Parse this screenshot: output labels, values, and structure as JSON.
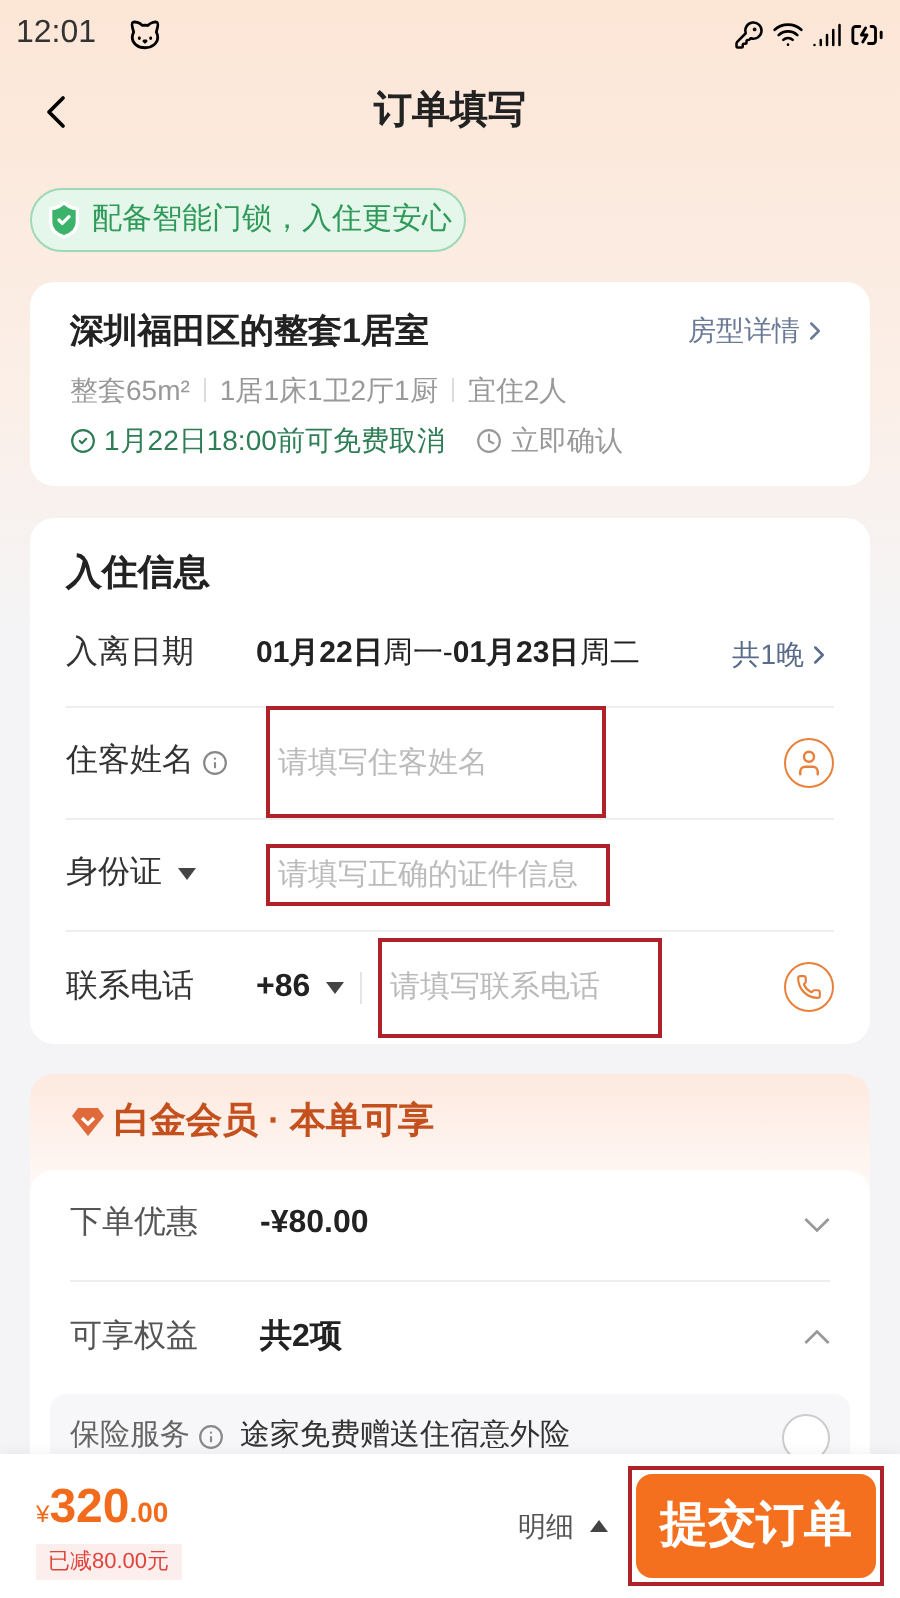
{
  "status_bar": {
    "time": "12:01"
  },
  "header": {
    "title": "订单填写"
  },
  "badge": {
    "text": "配备智能门锁，入住更安心"
  },
  "listing": {
    "title": "深圳福田区的整套1居室",
    "link": "房型详情",
    "specs": [
      "整套65m²",
      "1居1床1卫2厅1厨",
      "宜住2人"
    ],
    "cancellation": "1月22日18:00前可免费取消",
    "confirmation": "立即确认"
  },
  "checkin": {
    "title": "入住信息",
    "rows": [
      {
        "kind": "dates",
        "label": "入离日期",
        "value": "**01月22日**周一-**01月23日**周二",
        "link": "共1晚"
      },
      {
        "kind": "name",
        "label": "住客姓名",
        "placeholder": "请填写住客姓名"
      },
      {
        "kind": "id",
        "label": "身份证",
        "placeholder": "请填写正确的证件信息"
      },
      {
        "kind": "phone",
        "label": "联系电话",
        "code": "+86",
        "placeholder": "请填写联系电话"
      }
    ]
  },
  "member": {
    "title": "白金会员 · 本单可享",
    "rows": [
      {
        "label": "下单优惠",
        "value": "-¥80.00",
        "expanded": false
      },
      {
        "label": "可享权益",
        "value": "共2项",
        "expanded": true
      }
    ],
    "benefits": [
      {
        "label": "保险服务",
        "text": "途家免费赠送住宿意外险",
        "selected": false
      }
    ]
  },
  "footer": {
    "currency": "¥",
    "price": "320",
    "decimals": ".00",
    "discount": "已减80.00元",
    "details": "明细",
    "submit": "提交订单"
  }
}
